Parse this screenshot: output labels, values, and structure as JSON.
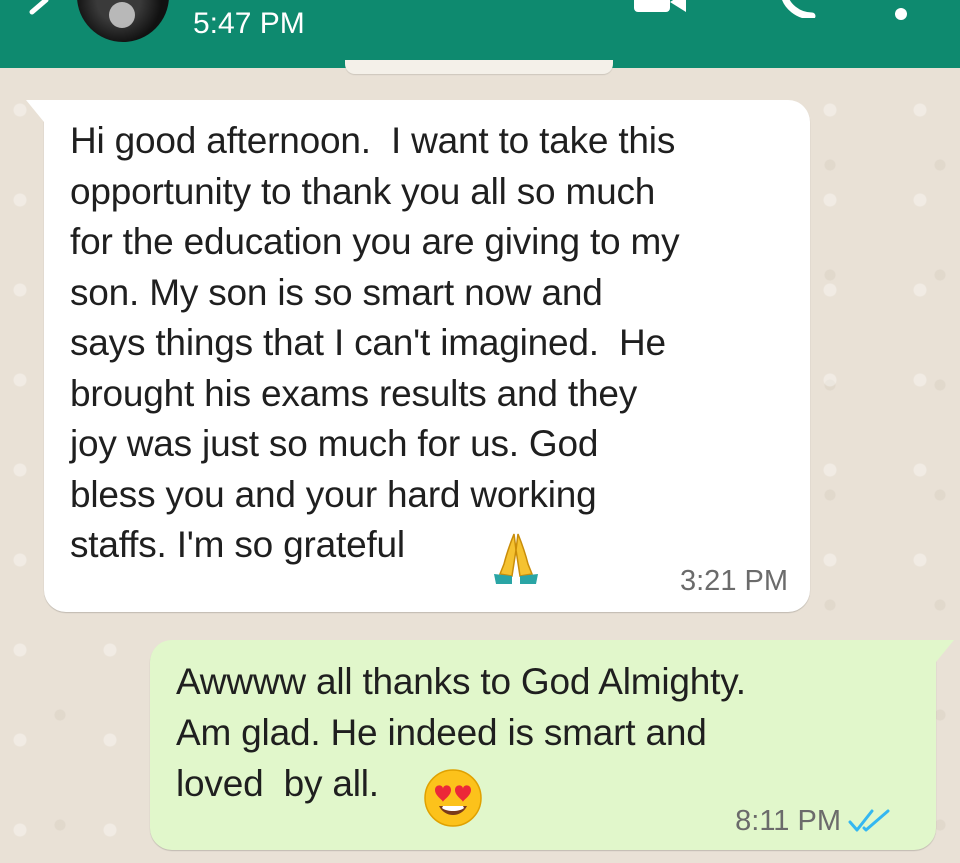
{
  "header": {
    "time": "5:47 PM",
    "color": "#0e8a6f"
  },
  "icons": {
    "back": "back-arrow-icon",
    "video": "video-call-icon",
    "call": "voice-call-icon",
    "more": "more-options-icon"
  },
  "messages": [
    {
      "direction": "incoming",
      "text": "Hi good afternoon.  I want to take this\nopportunity to thank you all so much\nfor the education you are giving to my\nson. My son is so smart now and\nsays things that I can't imagined.  He\nbrought his exams results and they\njoy was just so much for us. God\nbless you and your hard working\nstaffs. I'm so grateful",
      "emoji": "folded-hands",
      "time": "3:21 PM"
    },
    {
      "direction": "outgoing",
      "text": "Awwww all thanks to God Almighty.\nAm glad. He indeed is smart and\nloved  by all.",
      "emoji": "smiling-face-with-heart-eyes",
      "time": "8:11 PM",
      "status": "read"
    }
  ],
  "colors": {
    "incoming_bubble": "#ffffff",
    "outgoing_bubble": "#e1f7cb",
    "wallpaper": "#e9e1d6",
    "read_ticks": "#34b7f1"
  }
}
